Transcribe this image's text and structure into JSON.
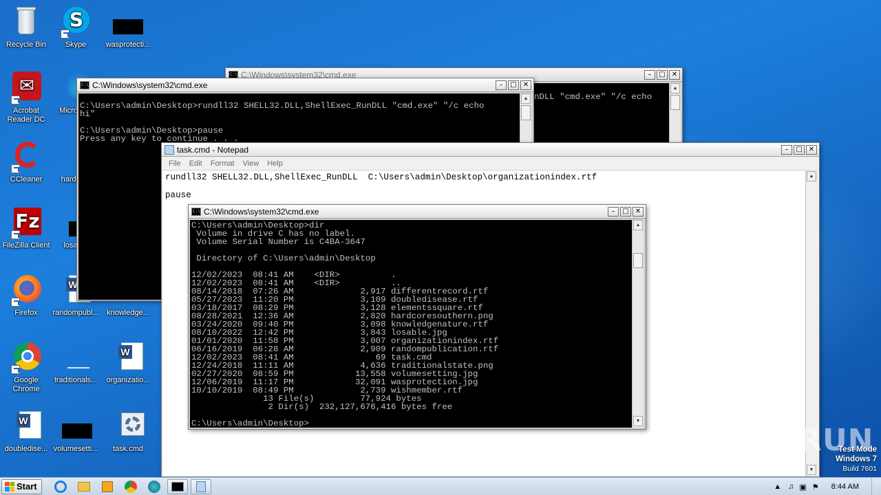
{
  "desktop": {
    "icons": [
      {
        "label": "Recycle Bin"
      },
      {
        "label": "Skype"
      },
      {
        "label": "wasprotecti..."
      },
      {
        "label": "Acrobat Reader DC"
      },
      {
        "label": "Microso..."
      },
      {
        "label": "CCleaner"
      },
      {
        "label": "hardco..."
      },
      {
        "label": "FileZilla Client"
      },
      {
        "label": "losab..."
      },
      {
        "label": "Firefox"
      },
      {
        "label": "randompubl..."
      },
      {
        "label": "knowledge..."
      },
      {
        "label": "Google Chrome"
      },
      {
        "label": "traditionals..."
      },
      {
        "label": "organizatio..."
      },
      {
        "label": "doubledise..."
      },
      {
        "label": "volumesetti..."
      },
      {
        "label": "task.cmd"
      }
    ]
  },
  "cmd_back": {
    "title": "C:\\Windows\\system32\\cmd.exe",
    "text": "nDLL \"cmd.exe\" \"/c echo"
  },
  "cmd_mid": {
    "title": "C:\\Windows\\system32\\cmd.exe",
    "text": "C:\\Users\\admin\\Desktop>rundll32 SHELL32.DLL,ShellExec_RunDLL \"cmd.exe\" \"/c echo\nhi\"\n\nC:\\Users\\admin\\Desktop>pause\nPress any key to continue . . ."
  },
  "notepad": {
    "title": "task.cmd - Notepad",
    "menu": [
      "File",
      "Edit",
      "Format",
      "View",
      "Help"
    ],
    "text": "rundll32 SHELL32.DLL,ShellExec_RunDLL  C:\\Users\\admin\\Desktop\\organizationindex.rtf\n\npause"
  },
  "cmd_front": {
    "title": "C:\\Windows\\system32\\cmd.exe",
    "text": "C:\\Users\\admin\\Desktop>dir\n Volume in drive C has no label.\n Volume Serial Number is C4BA-3647\n\n Directory of C:\\Users\\admin\\Desktop\n\n12/02/2023  08:41 AM    <DIR>          .\n12/02/2023  08:41 AM    <DIR>          ..\n08/14/2018  07:26 AM             2,917 differentrecord.rtf\n05/27/2023  11:20 PM             3,109 doubledisease.rtf\n03/18/2017  08:29 PM             3,128 elementssquare.rtf\n08/28/2021  12:36 AM             2,820 hardcoresouthern.png\n03/24/2020  09:40 PM             3,098 knowledgenature.rtf\n08/10/2022  12:42 PM             3,843 losable.jpg\n01/01/2020  11:58 PM             3,007 organizationindex.rtf\n06/16/2019  06:28 AM             2,909 randompublication.rtf\n12/02/2023  08:41 AM                69 task.cmd\n12/24/2018  11:11 AM             4,636 traditionalstate.png\n02/27/2020  08:59 PM            13,558 volumesetting.jpg\n12/06/2019  11:17 PM            32,091 wasprotection.jpg\n10/10/2019  08:49 PM             2,739 wishmember.rtf\n              13 File(s)         77,924 bytes\n               2 Dir(s)  232,127,676,416 bytes free\n\nC:\\Users\\admin\\Desktop>"
  },
  "taskbar": {
    "start_label": "Start",
    "clock": "8:44 AM"
  },
  "watermark": {
    "line1": "Test Mode",
    "line2": "Windows 7",
    "line3": "Build 7601",
    "brand": "ANY RUN"
  }
}
